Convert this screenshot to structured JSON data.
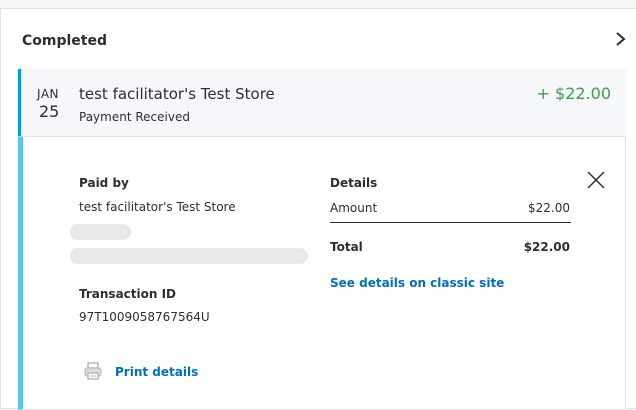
{
  "section": {
    "title": "Completed"
  },
  "transaction": {
    "month": "JAN",
    "day": "25",
    "name": "test facilitator's Test Store",
    "status": "Payment Received",
    "amount": "+ $22.00"
  },
  "details": {
    "paid_by_label": "Paid by",
    "paid_by_value": "test facilitator's Test Store",
    "transaction_id_label": "Transaction ID",
    "transaction_id_value": "97T1009058767564U",
    "print_label": "Print details",
    "details_label": "Details",
    "amount_label": "Amount",
    "amount_value": "$22.00",
    "total_label": "Total",
    "total_value": "$22.00",
    "classic_link": "See details on classic site"
  },
  "colors": {
    "accent_bar": "#009cde",
    "panel_bar": "#5bc4f1",
    "positive_amount": "#3e9e4a",
    "link": "#0070ba"
  },
  "icons": {
    "chevron": "chevron-right-icon",
    "close": "close-icon",
    "print": "printer-icon"
  }
}
